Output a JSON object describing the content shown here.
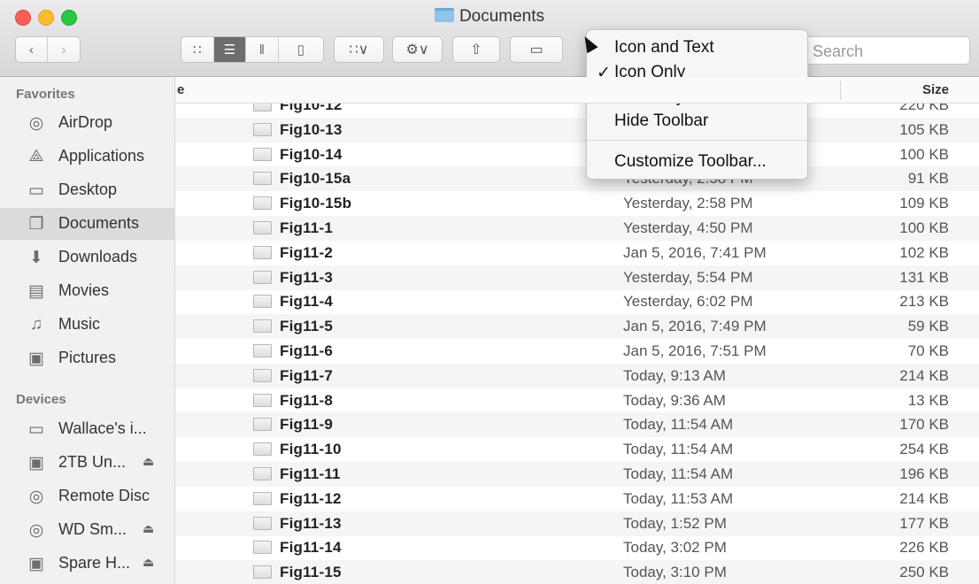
{
  "window": {
    "title": "Documents"
  },
  "toolbar": {
    "back_icon": "chevron-left-icon",
    "forward_icon": "chevron-right-icon",
    "view_modes": [
      "icon-view",
      "list-view",
      "column-view",
      "coverflow-view"
    ],
    "active_view": "list-view",
    "search_placeholder": "Search"
  },
  "sidebar": {
    "favorites_heading": "Favorites",
    "favorites": [
      {
        "label": "AirDrop",
        "icon": "airdrop-icon"
      },
      {
        "label": "Applications",
        "icon": "applications-icon"
      },
      {
        "label": "Desktop",
        "icon": "desktop-icon"
      },
      {
        "label": "Documents",
        "icon": "documents-icon",
        "selected": true
      },
      {
        "label": "Downloads",
        "icon": "downloads-icon"
      },
      {
        "label": "Movies",
        "icon": "movies-icon"
      },
      {
        "label": "Music",
        "icon": "music-icon"
      },
      {
        "label": "Pictures",
        "icon": "pictures-icon"
      }
    ],
    "devices_heading": "Devices",
    "devices": [
      {
        "label": "Wallace's i...",
        "icon": "computer-icon",
        "eject": false
      },
      {
        "label": "2TB Un...",
        "icon": "disk-icon",
        "eject": true
      },
      {
        "label": "Remote Disc",
        "icon": "disc-icon",
        "eject": false
      },
      {
        "label": "WD Sm...",
        "icon": "disc-icon",
        "eject": true
      },
      {
        "label": "Spare H...",
        "icon": "disk-icon",
        "eject": true
      }
    ],
    "eject_glyph": "⏏"
  },
  "list": {
    "header_name": "e",
    "header_size": "Size",
    "rows": [
      {
        "name": "Fig10-12",
        "date": "",
        "size": "220 KB"
      },
      {
        "name": "Fig10-13",
        "date": "",
        "size": "105 KB"
      },
      {
        "name": "Fig10-14",
        "date": "",
        "size": "100 KB"
      },
      {
        "name": "Fig10-15a",
        "date": "Yesterday, 2:58 PM",
        "size": "91 KB"
      },
      {
        "name": "Fig10-15b",
        "date": "Yesterday, 2:58 PM",
        "size": "109 KB"
      },
      {
        "name": "Fig11-1",
        "date": "Yesterday, 4:50 PM",
        "size": "100 KB"
      },
      {
        "name": "Fig11-2",
        "date": "Jan 5, 2016, 7:41 PM",
        "size": "102 KB"
      },
      {
        "name": "Fig11-3",
        "date": "Yesterday, 5:54 PM",
        "size": "131 KB"
      },
      {
        "name": "Fig11-4",
        "date": "Yesterday, 6:02 PM",
        "size": "213 KB"
      },
      {
        "name": "Fig11-5",
        "date": "Jan 5, 2016, 7:49 PM",
        "size": "59 KB"
      },
      {
        "name": "Fig11-6",
        "date": "Jan 5, 2016, 7:51 PM",
        "size": "70 KB"
      },
      {
        "name": "Fig11-7",
        "date": "Today, 9:13 AM",
        "size": "214 KB"
      },
      {
        "name": "Fig11-8",
        "date": "Today, 9:36 AM",
        "size": "13 KB"
      },
      {
        "name": "Fig11-9",
        "date": "Today, 11:54 AM",
        "size": "170 KB"
      },
      {
        "name": "Fig11-10",
        "date": "Today, 11:54 AM",
        "size": "254 KB"
      },
      {
        "name": "Fig11-11",
        "date": "Today, 11:54 AM",
        "size": "196 KB"
      },
      {
        "name": "Fig11-12",
        "date": "Today, 11:53 AM",
        "size": "214 KB"
      },
      {
        "name": "Fig11-13",
        "date": "Today, 1:52 PM",
        "size": "177 KB"
      },
      {
        "name": "Fig11-14",
        "date": "Today, 3:02 PM",
        "size": "226 KB"
      },
      {
        "name": "Fig11-15",
        "date": "Today, 3:10 PM",
        "size": "250 KB"
      }
    ]
  },
  "context_menu": {
    "items": [
      {
        "label": "Icon and Text",
        "checked": false
      },
      {
        "label": "Icon Only",
        "checked": true
      },
      {
        "label": "Text Only",
        "checked": false
      },
      {
        "label": "Hide Toolbar",
        "checked": false
      }
    ],
    "customize_label": "Customize Toolbar...",
    "check_glyph": "✓"
  }
}
